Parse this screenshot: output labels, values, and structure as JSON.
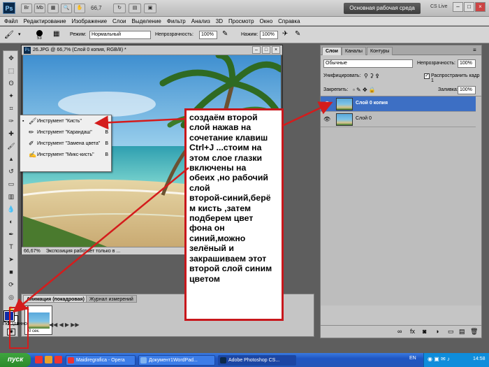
{
  "app": {
    "logo": "Ps",
    "zoom": "66,7",
    "workspace": "Основная рабочая среда",
    "cs_live": "CS Live",
    "win_min": "–",
    "win_max": "□",
    "win_close": "×"
  },
  "menu": [
    "Файл",
    "Редактирование",
    "Изображение",
    "Слои",
    "Выделение",
    "Фильтр",
    "Анализ",
    "3D",
    "Просмотр",
    "Окно",
    "Справка"
  ],
  "options": {
    "brush_size": "53",
    "mode_label": "Режим:",
    "mode_value": "Нормальный",
    "opacity_label": "Непрозрачность:",
    "opacity_value": "100%",
    "pressure_label": "Нажим:",
    "pressure_value": "100%"
  },
  "document": {
    "title": "26.JPG @ 66,7% (Слой 0 копия, RGB/8) *",
    "status_zoom": "66,67%",
    "status_text": "Экспозиция работает только в ..."
  },
  "flyout": {
    "items": [
      {
        "label": "Инструмент \"Кисть\"",
        "key": "B",
        "bullet": "▪"
      },
      {
        "label": "Инструмент \"Карандаш\"",
        "key": "B",
        "bullet": ""
      },
      {
        "label": "Инструмент \"Замена цвета\"",
        "key": "B",
        "bullet": ""
      },
      {
        "label": "Инструмент \"Микс-кисть\"",
        "key": "B",
        "bullet": ""
      }
    ]
  },
  "annotation": {
    "text": "создаём  второй\nслой нажав на\nсочетание клавиш\nCtrl+J   ...стоим на\nэтом слое глазки\nвключены на\nобеих ,но рабочий\nслой\nвторой-синий,берё\nм кисть ,затем\nподберем цвет\nфона он\nсиний,можно\nзелёный и\nзакрашиваем этот\nвторой слой синим\nцветом"
  },
  "layers_panel": {
    "tabs": [
      "Слои",
      "Каналы",
      "Контуры"
    ],
    "blend_mode": "Обычные",
    "opacity_label": "Непрозрачность:",
    "opacity_value": "100%",
    "unify_label": "Унифицировать:",
    "propagate_label": "Распространить кадр 1",
    "lock_label": "Закрепить:",
    "fill_label": "Заливка:",
    "fill_value": "100%",
    "layers": [
      {
        "name": "Слой 0 копия",
        "selected": true
      },
      {
        "name": "Слой 0",
        "selected": false
      }
    ]
  },
  "animation_panel": {
    "tabs": [
      "Анимация (покадровая)",
      "Журнал измерений"
    ],
    "frame_number": "1",
    "frame_duration": "0 сек.",
    "loop": "Постоянно"
  },
  "taskbar": {
    "start": "пуск",
    "tasks": [
      "Maidiregrafica - Opera",
      "Документ1WordPad...",
      "Adobe Photoshop CS..."
    ],
    "lang": "EN",
    "clock": "14:58"
  },
  "colors": {
    "foreground": "#0e2aa6",
    "background": "#ffffff",
    "annotation_border": "#c8171c",
    "selected_layer": "#3d6fc4"
  }
}
